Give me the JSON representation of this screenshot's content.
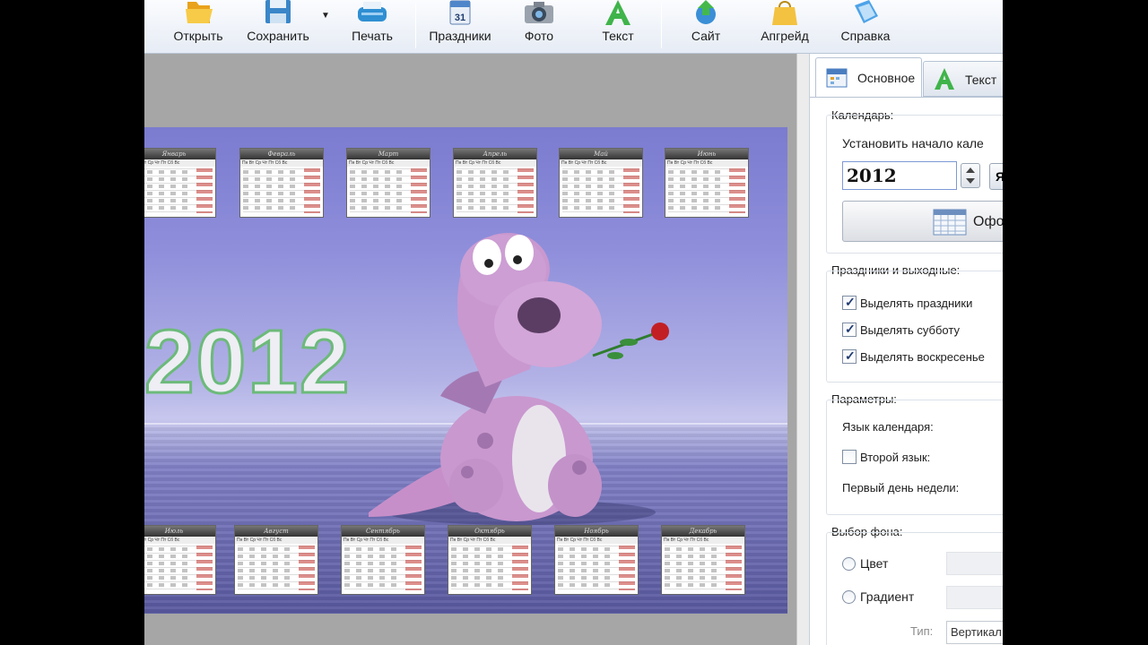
{
  "toolbar": {
    "buttons": [
      {
        "label": "Открыть",
        "icon": "folder-open-icon"
      },
      {
        "label": "Сохранить",
        "icon": "floppy-disk-icon"
      },
      {
        "label": "Печать",
        "icon": "printer-icon"
      },
      {
        "label": "Праздники",
        "icon": "calendar-31-icon"
      },
      {
        "label": "Фото",
        "icon": "camera-icon"
      },
      {
        "label": "Текст",
        "icon": "letter-a-icon"
      },
      {
        "label": "Сайт",
        "icon": "globe-arrow-icon"
      },
      {
        "label": "Апгрейд",
        "icon": "shopping-bag-icon"
      },
      {
        "label": "Справка",
        "icon": "help-book-icon"
      }
    ]
  },
  "poster": {
    "year": "2012",
    "months": [
      "Январь",
      "Февраль",
      "Март",
      "Апрель",
      "Май",
      "Июнь",
      "Июль",
      "Август",
      "Сентябрь",
      "Октябрь",
      "Ноябрь",
      "Декабрь"
    ],
    "weekdays": "Пн Вт Ср Чт Пт Сб Вс"
  },
  "panel": {
    "tabs": [
      {
        "label": "Основное",
        "icon": "calendar-tab-icon"
      },
      {
        "label": "Текст",
        "icon": "green-a-icon"
      }
    ],
    "calendar": {
      "title": "Календарь:",
      "start_label": "Установить начало кале",
      "year_value": "2012",
      "lang_button": "Я",
      "design_button": "Офо"
    },
    "holidays": {
      "title": "Праздники и выходные:",
      "items": [
        {
          "label": "Выделять праздники",
          "checked": true
        },
        {
          "label": "Выделять субботу",
          "checked": true
        },
        {
          "label": "Выделять воскресенье",
          "checked": true
        }
      ]
    },
    "params": {
      "title": "Параметры:",
      "lang_label": "Язык календаря:",
      "second_lang_label": "Второй язык:",
      "second_lang_checked": false,
      "first_day_label": "Первый день недели:"
    },
    "background": {
      "title": "Выбор фона:",
      "color_label": "Цвет",
      "gradient_label": "Градиент",
      "type_label": "Тип:",
      "type_value": "Вертикал"
    }
  },
  "colors": {
    "accent": "#7d9ad6",
    "holiday_red": "#c0332e",
    "year_outline": "#6cba7a"
  }
}
